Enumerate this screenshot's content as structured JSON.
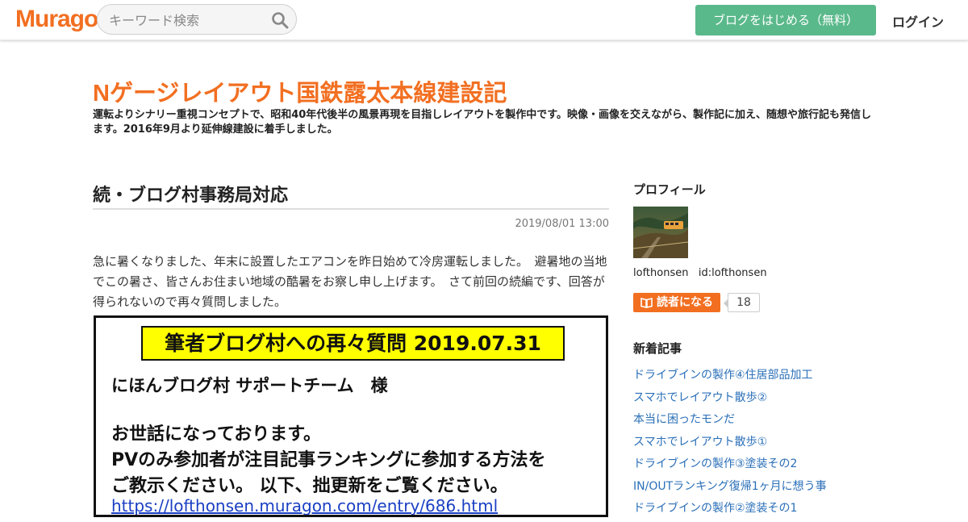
{
  "header": {
    "logo": "Muragon",
    "search_placeholder": "キーワード検索",
    "start_blog_label": "ブログをはじめる（無料）",
    "login_label": "ログイン"
  },
  "blog": {
    "title": "Nゲージレイアウト国鉄露太本線建設記",
    "description": "運転よりシナリー重視コンセプトで、昭和40年代後半の風景再現を目指しレイアウトを製作中です。映像・画像を交えながら、製作記に加え、随想や旅行記も発信します。2016年9月より延伸線建設に着手しました。"
  },
  "post": {
    "title": "続・ブログ村事務局対応",
    "date": "2019/08/01 13:00",
    "body": "急に暑くなりました、年末に設置したエアコンを昨日始めて冷房運転しました。　避暑地の当地でこの暑さ、皆さんお住まい地域の酷暑をお察し申し上げます。　さて前回の続編です、回答が得られないので再々質問しました。",
    "image": {
      "banner": "筆者ブログ村への再々質問  2019.07.31",
      "line1": "にほんブログ村 サポートチーム　様",
      "line2": "お世話になっております。",
      "line3": "PVのみ参加者が注目記事ランキングに参加する方法を",
      "line4": "ご教示ください。 以下、拙更新をご覧ください。",
      "link": "https://lofthonsen.muragon.com/entry/686.html"
    }
  },
  "sidebar": {
    "profile_heading": "プロフィール",
    "username": "lofthonsen",
    "user_id": "id:lofthonsen",
    "follow_label": "読者になる",
    "follower_count": "18",
    "recent_heading": "新着記事",
    "recent_posts": [
      "ドライブインの製作④住居部品加工",
      "スマホでレイアウト散歩②",
      "本当に困ったモンだ",
      "スマホでレイアウト散歩①",
      "ドライブインの製作③塗装その2",
      "IN/OUTランキング復帰1ヶ月に想う事",
      "ドライブインの製作②塗装その1"
    ]
  },
  "colors": {
    "brand": "#f26f21",
    "button_green": "#5ab98b",
    "link_blue": "#2a6fb8",
    "banner_yellow": "#ffff00"
  }
}
